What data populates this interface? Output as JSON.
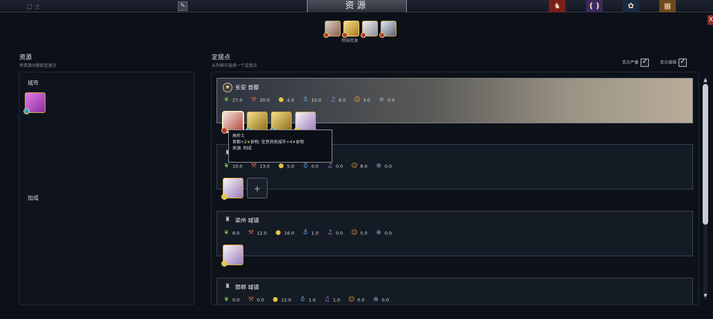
{
  "window": {
    "title": "资源",
    "faded_left_text": "口 士",
    "close_label": "X"
  },
  "filter": {
    "label": "帝国资源",
    "icons": [
      "kaolin-icon",
      "gold-bars-icon",
      "artifact-icon",
      "globe-icon"
    ]
  },
  "left": {
    "heading": "资源",
    "subheading": "将资源分配给定居点",
    "city_label": "城市",
    "bonus_label": "加成"
  },
  "right": {
    "heading": "定居点",
    "subheading": "从列表中选择一个定居点",
    "toggle_yield": "显示产量",
    "toggle_towns": "显示城镇"
  },
  "colors": {
    "accent_gold": "#d7a93c",
    "food": "#7ec04a",
    "production": "#c7644d",
    "gold": "#e6c24a",
    "science": "#5fa8e6",
    "culture": "#a986e8",
    "happiness": "#f2a43a",
    "influence": "#8fa6c2"
  },
  "settlements": [
    {
      "name": "长安 首都",
      "type": "capital",
      "selected": true,
      "yields": [
        "27.0",
        "20.0",
        "4.0",
        "10.0",
        "6.0",
        "3.0",
        "0.0"
      ],
      "resources": [
        "kaolin",
        "spice",
        "spice",
        "cotton"
      ]
    },
    {
      "name": "",
      "type": "town",
      "selected": false,
      "yields": [
        "10.0",
        "13.0",
        "5.0",
        "0.0",
        "0.0",
        "8.0",
        "0.0"
      ],
      "resources": [
        "cotton",
        "empty"
      ]
    },
    {
      "name": "梁州 城镇",
      "type": "town",
      "selected": false,
      "yields": [
        "8.0",
        "12.0",
        "16.0",
        "1.0",
        "0.0",
        "5.0",
        "0.0"
      ],
      "resources": [
        "cotton"
      ]
    },
    {
      "name": "邯郸 城镇",
      "type": "town",
      "selected": false,
      "yields": [
        "0.0",
        "0.0",
        "12.0",
        "1.0",
        "1.0",
        "0.0",
        "0.0"
      ],
      "resources": []
    }
  ],
  "tooltip": {
    "title": "高岭土",
    "line1_a": "首都+2",
    "line1_b": "食物; 任意其他城市+4",
    "line1_c": "食物",
    "line2": "来源: 制成"
  },
  "empty_slot_symbol": "+"
}
